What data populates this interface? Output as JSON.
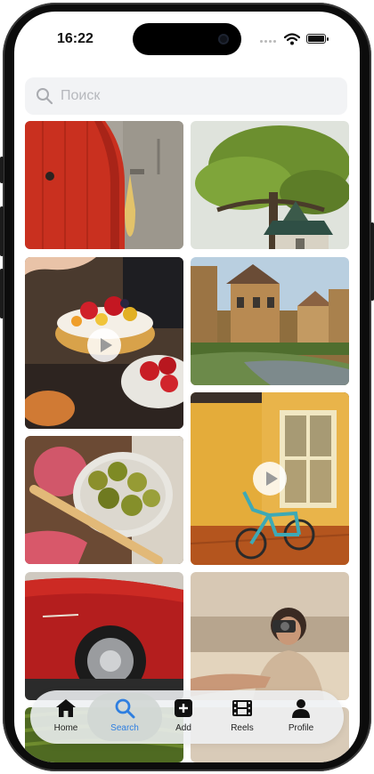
{
  "status_bar": {
    "time": "16:22"
  },
  "search": {
    "placeholder": "Поиск"
  },
  "grid": {
    "tiles": [
      {
        "name": "photo-red-door",
        "video": false
      },
      {
        "name": "photo-tree-gazebo",
        "video": false
      },
      {
        "name": "photo-strawberry-tart",
        "video": true
      },
      {
        "name": "photo-old-town-river",
        "video": false
      },
      {
        "name": "photo-olives-platter",
        "video": false
      },
      {
        "name": "photo-bicycle-yellow-wall",
        "video": true
      },
      {
        "name": "photo-red-car",
        "video": false
      },
      {
        "name": "photo-woman-camera-beach",
        "video": false
      },
      {
        "name": "photo-green-field",
        "video": false
      },
      {
        "name": "photo-beach-bottom",
        "video": false
      }
    ]
  },
  "tabbar": {
    "items": [
      {
        "label": "Home",
        "icon": "home-icon",
        "active": false
      },
      {
        "label": "Search",
        "icon": "search-icon",
        "active": true
      },
      {
        "label": "Add",
        "icon": "add-icon",
        "active": false
      },
      {
        "label": "Reels",
        "icon": "reels-icon",
        "active": false
      },
      {
        "label": "Profile",
        "icon": "profile-icon",
        "active": false
      }
    ]
  },
  "colors": {
    "accent": "#2f7fe0",
    "search_bg": "#f2f3f5"
  }
}
